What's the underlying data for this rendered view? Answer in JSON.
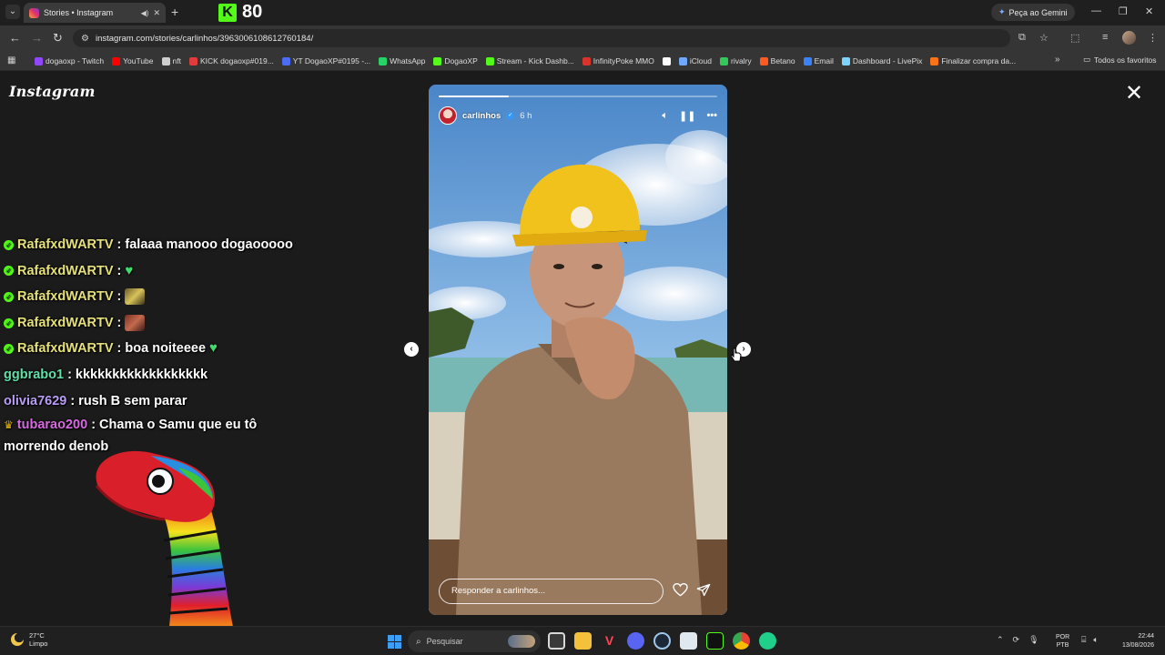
{
  "browser": {
    "tab_title": "Stories • Instagram",
    "tab_audio_icon": "speaker-icon",
    "tab_close": "✕",
    "new_tab": "+",
    "gemini_label": "Peça ao Gemini",
    "url": "instagram.com/stories/carlinhos/3963006108612760184/",
    "bookmarks": [
      {
        "label": "dogaoxp - Twitch",
        "color": "#9146ff"
      },
      {
        "label": "YouTube",
        "color": "#ff0000"
      },
      {
        "label": "nft",
        "color": "#cfcfcf"
      },
      {
        "label": "KICK dogaoxp#019...",
        "color": "#e23b3b"
      },
      {
        "label": "YT DogaoXP#0195 -...",
        "color": "#4a6cf7"
      },
      {
        "label": "WhatsApp",
        "color": "#25d366"
      },
      {
        "label": "DogaoXP",
        "color": "#53fc18"
      },
      {
        "label": "Stream - Kick Dashb...",
        "color": "#53fc18"
      },
      {
        "label": "InfinityPoke MMO",
        "color": "#d9342b"
      },
      {
        "label": "",
        "color": "#ffffff"
      },
      {
        "label": "iCloud",
        "color": "#6fa8ff"
      },
      {
        "label": "rivalry",
        "color": "#34c759"
      },
      {
        "label": "Betano",
        "color": "#ff5a1f"
      },
      {
        "label": "Email",
        "color": "#3b82f6"
      },
      {
        "label": "Dashboard - LivePix",
        "color": "#7dd3fc"
      },
      {
        "label": "Finalizar compra da...",
        "color": "#f97316"
      }
    ],
    "bookmarks_more": "»",
    "all_bookmarks": "Todos os favoritos"
  },
  "stream_overlay": {
    "kick_logo": "K",
    "viewer_count": "80",
    "chat": [
      {
        "user": "RafafxdWARTV",
        "user_color": "#e5e07a",
        "message": ": falaaa manooo dogaooooo",
        "badge": "kick",
        "emote": ""
      },
      {
        "user": "RafafxdWARTV",
        "user_color": "#e5e07a",
        "message": ":",
        "badge": "kick",
        "emote": "heart"
      },
      {
        "user": "RafafxdWARTV",
        "user_color": "#e5e07a",
        "message": ":",
        "badge": "kick",
        "emote": "image-a"
      },
      {
        "user": "RafafxdWARTV",
        "user_color": "#e5e07a",
        "message": ":",
        "badge": "kick",
        "emote": "image-b"
      },
      {
        "user": "RafafxdWARTV",
        "user_color": "#e5e07a",
        "message": ": boa noiteeee",
        "badge": "kick",
        "emote": "heart"
      },
      {
        "user": "ggbrabo1",
        "user_color": "#5ee0a8",
        "message": ": kkkkkkkkkkkkkkkkkk",
        "badge": "",
        "emote": ""
      },
      {
        "user": "olivia7629",
        "user_color": "#b99cf5",
        "message": ": rush B sem parar",
        "badge": "",
        "emote": ""
      },
      {
        "user": "tubarao200",
        "user_color": "#d66ae0",
        "message": ": Chama o Samu que eu tô morrendo denob",
        "badge": "crown",
        "emote": ""
      }
    ]
  },
  "instagram": {
    "logo": "Instagram",
    "close": "✕",
    "story": {
      "username": "carlinhos",
      "time": "6 h",
      "progress": 0.25,
      "reply_placeholder": "Responder a carlinhos...",
      "controls": [
        "mute-icon",
        "pause-icon",
        "more-icon",
        "like-icon",
        "share-icon"
      ]
    }
  },
  "taskbar": {
    "weather_temp": "27°C",
    "weather_desc": "Limpo",
    "search_label": "Pesquisar",
    "lang_top": "POR",
    "lang_bottom": "PTB",
    "time": "22:44",
    "date": "13/08/2026"
  }
}
